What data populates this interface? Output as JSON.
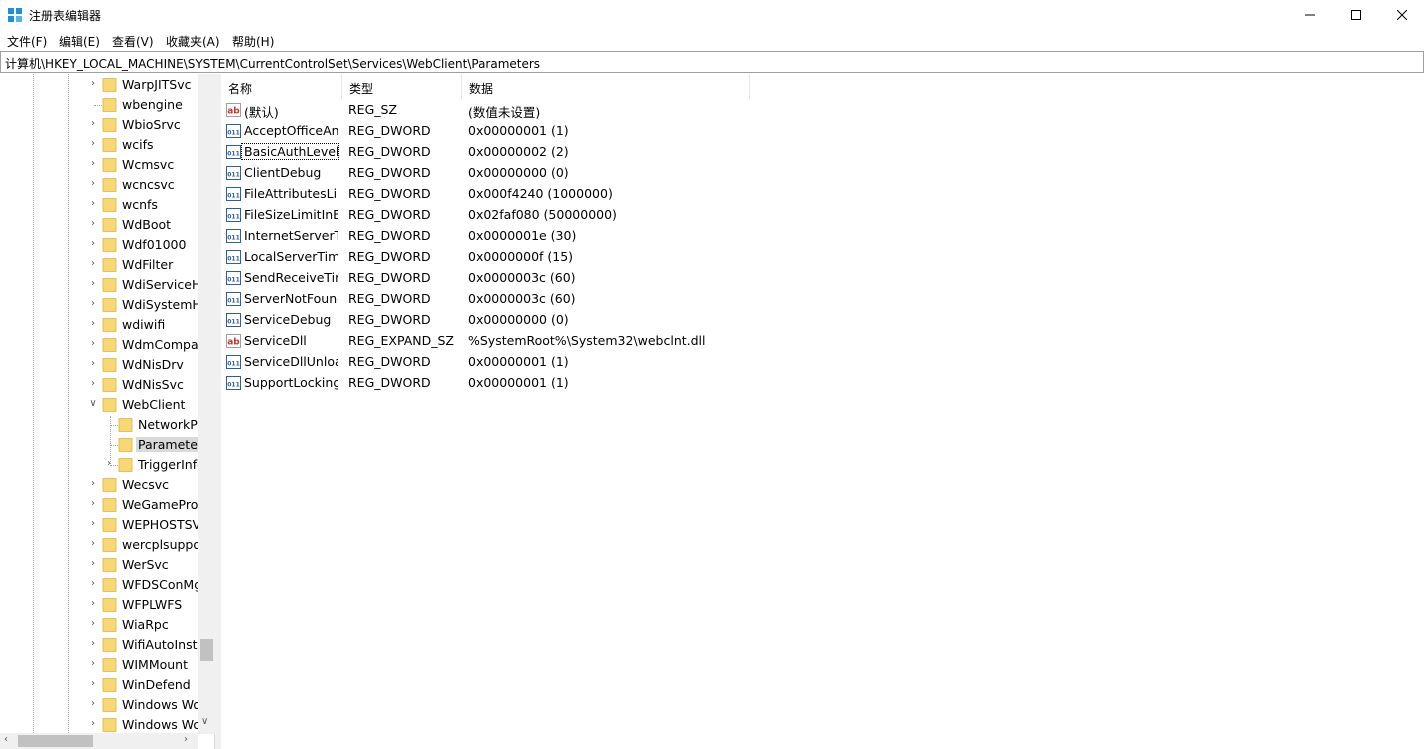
{
  "window": {
    "title": "注册表编辑器",
    "icon": "regedit-icon",
    "controls": [
      "minimize-icon",
      "maximize-icon",
      "close-icon"
    ]
  },
  "menu": [
    "文件(F)",
    "编辑(E)",
    "查看(V)",
    "收藏夹(A)",
    "帮助(H)"
  ],
  "address": "计算机\\HKEY_LOCAL_MACHINE\\SYSTEM\\CurrentControlSet\\Services\\WebClient\\Parameters",
  "tree": {
    "items": [
      {
        "label": "WarpJITSvc",
        "expandable": true
      },
      {
        "label": "wbengine",
        "expandable": false
      },
      {
        "label": "WbioSrvc",
        "expandable": true
      },
      {
        "label": "wcifs",
        "expandable": true
      },
      {
        "label": "Wcmsvc",
        "expandable": true
      },
      {
        "label": "wcncsvc",
        "expandable": true
      },
      {
        "label": "wcnfs",
        "expandable": true
      },
      {
        "label": "WdBoot",
        "expandable": true
      },
      {
        "label": "Wdf01000",
        "expandable": true
      },
      {
        "label": "WdFilter",
        "expandable": true
      },
      {
        "label": "WdiServiceHost",
        "expandable": true
      },
      {
        "label": "WdiSystemHost",
        "expandable": true
      },
      {
        "label": "wdiwifi",
        "expandable": true
      },
      {
        "label": "WdmCompanionFilter",
        "expandable": true
      },
      {
        "label": "WdNisDrv",
        "expandable": true
      },
      {
        "label": "WdNisSvc",
        "expandable": true
      },
      {
        "label": "WebClient",
        "expandable": true,
        "expanded": true
      },
      {
        "label": "NetworkProvider",
        "child": true,
        "expandable": false
      },
      {
        "label": "Parameters",
        "child": true,
        "expandable": false,
        "selected": true
      },
      {
        "label": "TriggerInfo",
        "child": true,
        "expandable": true
      },
      {
        "label": "Wecsvc",
        "expandable": true
      },
      {
        "label": "WeGameProtect",
        "expandable": true
      },
      {
        "label": "WEPHOSTSVC",
        "expandable": true
      },
      {
        "label": "wercplsupport",
        "expandable": true
      },
      {
        "label": "WerSvc",
        "expandable": true
      },
      {
        "label": "WFDSConMgrSvc",
        "expandable": true
      },
      {
        "label": "WFPLWFS",
        "expandable": true
      },
      {
        "label": "WiaRpc",
        "expandable": true
      },
      {
        "label": "WifiAutoInstallSrv",
        "expandable": true
      },
      {
        "label": "WIMMount",
        "expandable": true
      },
      {
        "label": "WinDefend",
        "expandable": true
      },
      {
        "label": "Windows Workflow",
        "expandable": true
      },
      {
        "label": "Windows Workflow",
        "expandable": true
      }
    ]
  },
  "values": {
    "headers": {
      "name": "名称",
      "type": "类型",
      "data": "数据"
    },
    "rows": [
      {
        "name": "(默认)",
        "type": "REG_SZ",
        "data": "(数值未设置)",
        "icon": "string-value-icon"
      },
      {
        "name": "AcceptOfficeAndTahoeServers",
        "type": "REG_DWORD",
        "data": "0x00000001 (1)",
        "icon": "binary-value-icon"
      },
      {
        "name": "BasicAuthLevel",
        "type": "REG_DWORD",
        "data": "0x00000002 (2)",
        "icon": "binary-value-icon",
        "focused": true
      },
      {
        "name": "ClientDebug",
        "type": "REG_DWORD",
        "data": "0x00000000 (0)",
        "icon": "binary-value-icon"
      },
      {
        "name": "FileAttributesLimitInBytes",
        "type": "REG_DWORD",
        "data": "0x000f4240 (1000000)",
        "icon": "binary-value-icon"
      },
      {
        "name": "FileSizeLimitInBytes",
        "type": "REG_DWORD",
        "data": "0x02faf080 (50000000)",
        "icon": "binary-value-icon"
      },
      {
        "name": "InternetServerTimeoutInSec",
        "type": "REG_DWORD",
        "data": "0x0000001e (30)",
        "icon": "binary-value-icon"
      },
      {
        "name": "LocalServerTimeoutInSec",
        "type": "REG_DWORD",
        "data": "0x0000000f (15)",
        "icon": "binary-value-icon"
      },
      {
        "name": "SendReceiveTimeoutInSec",
        "type": "REG_DWORD",
        "data": "0x0000003c (60)",
        "icon": "binary-value-icon"
      },
      {
        "name": "ServerNotFoundCacheLifeTimeInSec",
        "type": "REG_DWORD",
        "data": "0x0000003c (60)",
        "icon": "binary-value-icon"
      },
      {
        "name": "ServiceDebug",
        "type": "REG_DWORD",
        "data": "0x00000000 (0)",
        "icon": "binary-value-icon"
      },
      {
        "name": "ServiceDll",
        "type": "REG_EXPAND_SZ",
        "data": "%SystemRoot%\\System32\\webclnt.dll",
        "icon": "string-value-icon"
      },
      {
        "name": "ServiceDllUnloadOnStop",
        "type": "REG_DWORD",
        "data": "0x00000001 (1)",
        "icon": "binary-value-icon"
      },
      {
        "name": "SupportLocking",
        "type": "REG_DWORD",
        "data": "0x00000001 (1)",
        "icon": "binary-value-icon"
      }
    ]
  },
  "colors": {
    "folder": "#f8d775",
    "folder_edge": "#e0b447",
    "selection": "#d9d9d9",
    "string_icon_red": "#c0392b",
    "binary_icon_blue": "#2f5f9e"
  }
}
